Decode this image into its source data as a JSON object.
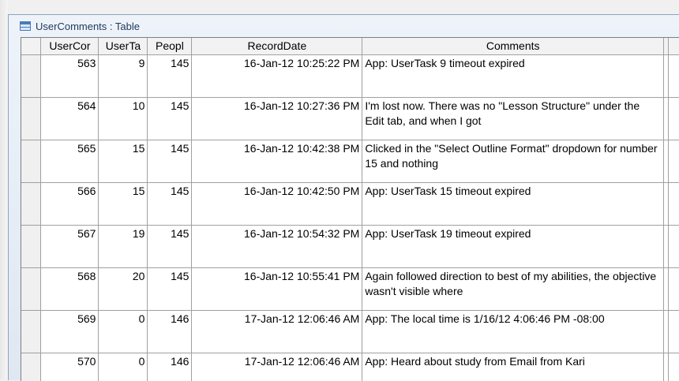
{
  "window": {
    "title": "UserComments : Table"
  },
  "columns": [
    "UserCommentID",
    "UserTaskID",
    "PeopleID",
    "RecordDate",
    "Comments"
  ],
  "columns_display": [
    "UserCor",
    "UserTa",
    "Peopl",
    "RecordDate",
    "Comments"
  ],
  "rows": [
    {
      "id": "563",
      "task": "9",
      "people": "145",
      "date": "16-Jan-12 10:25:22 PM",
      "comment": "App: UserTask 9 timeout expired"
    },
    {
      "id": "564",
      "task": "10",
      "people": "145",
      "date": "16-Jan-12 10:27:36 PM",
      "comment": "I'm lost now. There was no \"Lesson Structure\" under the Edit tab, and when I got"
    },
    {
      "id": "565",
      "task": "15",
      "people": "145",
      "date": "16-Jan-12 10:42:38 PM",
      "comment": "Clicked in the \"Select Outline Format\" dropdown for number 15 and nothing"
    },
    {
      "id": "566",
      "task": "15",
      "people": "145",
      "date": "16-Jan-12 10:42:50 PM",
      "comment": "App: UserTask 15 timeout expired"
    },
    {
      "id": "567",
      "task": "19",
      "people": "145",
      "date": "16-Jan-12 10:54:32 PM",
      "comment": "App: UserTask 19 timeout expired"
    },
    {
      "id": "568",
      "task": "20",
      "people": "145",
      "date": "16-Jan-12 10:55:41 PM",
      "comment": "Again followed direction to best of my abilities, the objective wasn't visible where"
    },
    {
      "id": "569",
      "task": "0",
      "people": "146",
      "date": "17-Jan-12 12:06:46 AM",
      "comment": "App: The local time is 1/16/12 4:06:46 PM -08:00"
    },
    {
      "id": "570",
      "task": "0",
      "people": "146",
      "date": "17-Jan-12 12:06:46 AM",
      "comment": "App: Heard about study from Email from Kari"
    }
  ]
}
